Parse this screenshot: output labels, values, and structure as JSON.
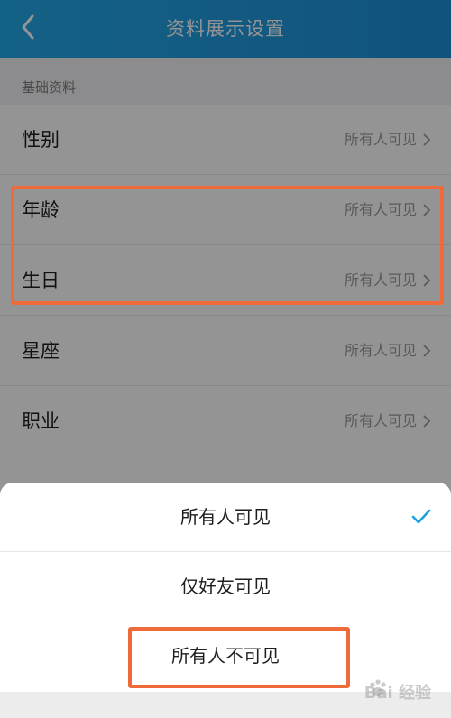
{
  "header": {
    "title": "资料展示设置",
    "back_icon": "chevron-left-icon"
  },
  "section": {
    "label": "基础资料"
  },
  "rows": [
    {
      "label": "性别",
      "value": "所有人可见"
    },
    {
      "label": "年龄",
      "value": "所有人可见"
    },
    {
      "label": "生日",
      "value": "所有人可见"
    },
    {
      "label": "星座",
      "value": "所有人可见"
    },
    {
      "label": "职业",
      "value": "所有人可见"
    }
  ],
  "sheet": {
    "options": [
      {
        "label": "所有人可见",
        "selected": true
      },
      {
        "label": "仅好友可见",
        "selected": false
      },
      {
        "label": "所有人不可见",
        "selected": false
      }
    ],
    "check_icon": "checkmark-icon"
  },
  "colors": {
    "header": "#1d8fd6",
    "accent": "#1ba1e2",
    "highlight": "#ef6a3b"
  },
  "watermark": {
    "text": "Bai 经验"
  }
}
